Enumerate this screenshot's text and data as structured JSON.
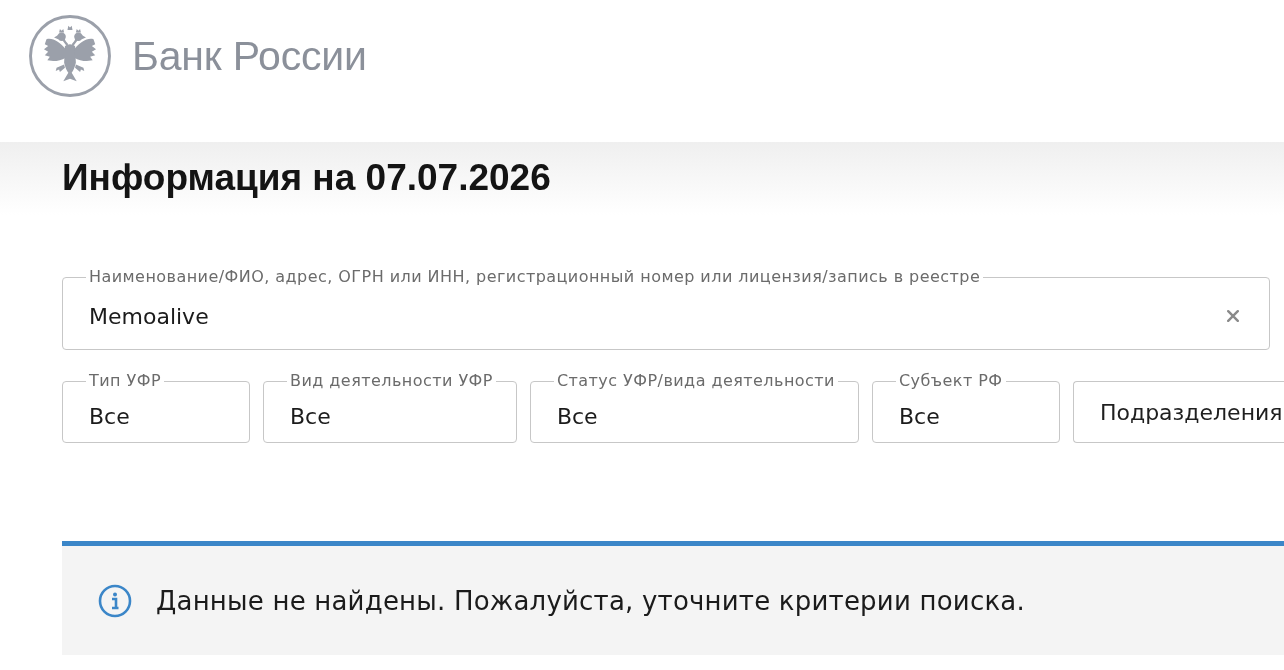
{
  "header": {
    "logo_text": "Банк России"
  },
  "title": "Информация на 07.07.2026",
  "search": {
    "label": "Наименование/ФИО, адрес, ОГРН или ИНН, регистрационный номер или лицензия/запись в реестре",
    "value": "Memoalive"
  },
  "filters": [
    {
      "label": "Тип УФР",
      "value": "Все"
    },
    {
      "label": "Вид деятельности УФР",
      "value": "Все"
    },
    {
      "label": "Статус УФР/вида деятельности",
      "value": "Все"
    },
    {
      "label": "Субъект РФ",
      "value": "Все"
    },
    {
      "placeholder": "Подразделения"
    }
  ],
  "alert": {
    "kind": "info",
    "message": "Данные не найдены. Пожалуйста, уточните критерии поиска."
  }
}
